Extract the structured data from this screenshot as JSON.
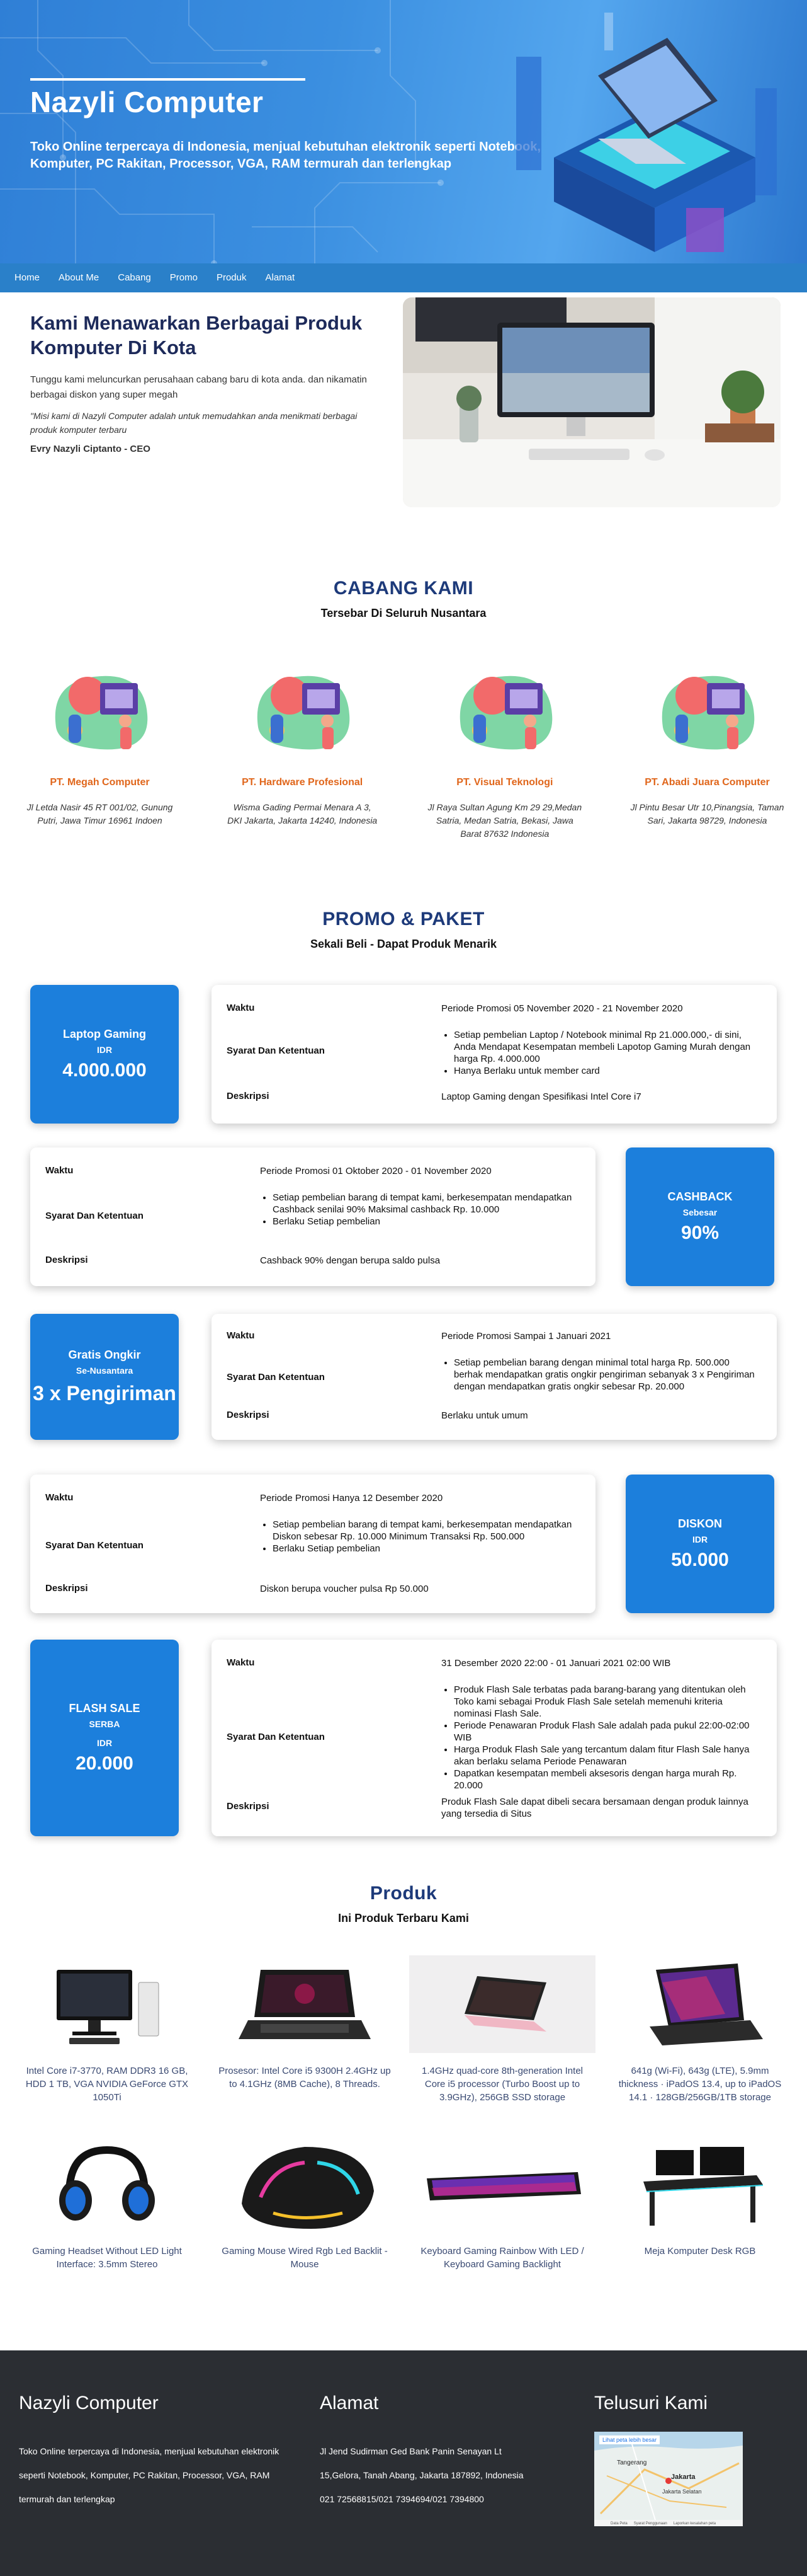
{
  "hero": {
    "title": "Nazyli Computer",
    "tagline": "Toko Online terpercaya di Indonesia, menjual kebutuhan elektronik seperti Notebook, Komputer, PC Rakitan, Processor, VGA, RAM termurah dan terlengkap"
  },
  "nav": [
    "Home",
    "About Me",
    "Cabang",
    "Promo",
    "Produk",
    "Alamat"
  ],
  "about": {
    "heading": "Kami Menawarkan Berbagai Produk Komputer Di Kota",
    "lead": "Tunggu kami meluncurkan perusahaan cabang baru di kota anda. dan nikamatin berbagai diskon yang super megah",
    "quote": "\"Misi kami di Nazyli Computer adalah untuk memudahkan anda menikmati berbagai produk komputer terbaru",
    "ceo": "Evry Nazyli Ciptanto - CEO"
  },
  "cabang": {
    "title": "CABANG KAMI",
    "subtitle": "Tersebar Di Seluruh Nusantara",
    "items": [
      {
        "name": "PT. Megah Computer",
        "address": "Jl Letda Nasir 45 RT 001/02, Gunung Putri, Jawa Timur 16961 Indoen"
      },
      {
        "name": "PT. Hardware Profesional",
        "address": "Wisma Gading Permai Menara A 3, DKI Jakarta, Jakarta 14240, Indonesia"
      },
      {
        "name": "PT. Visual Teknologi",
        "address": "Jl Raya Sultan Agung Km 29 29,Medan Satria, Medan Satria, Bekasi, Jawa Barat 87632 Indonesia"
      },
      {
        "name": "PT. Abadi Juara Computer",
        "address": "Jl Pintu Besar Utr 10,Pinangsia, Taman Sari, Jakarta 98729, Indonesia"
      }
    ]
  },
  "promo": {
    "title": "PROMO & PAKET",
    "subtitle": "Sekali Beli - Dapat Produk Menarik",
    "labels": {
      "waktu": "Waktu",
      "syarat": "Syarat Dan Ketentuan",
      "deskripsi": "Deskripsi"
    },
    "items": [
      {
        "badge": [
          "Laptop Gaming",
          "IDR",
          "4.000.000"
        ],
        "waktu": "Periode Promosi 05 November 2020 - 21 November 2020",
        "syarat": [
          "Setiap pembelian Laptop / Notebook minimal Rp 21.000.000,- di sini, Anda Mendapat Kesempatan membeli Lapotop Gaming Murah dengan harga Rp. 4.000.000",
          "Hanya Berlaku untuk member card"
        ],
        "deskripsi": "Laptop Gaming dengan Spesifikasi Intel Core i7"
      },
      {
        "badge": [
          "CASHBACK",
          "Sebesar",
          "90%"
        ],
        "waktu": "Periode Promosi 01 Oktober 2020 - 01 November 2020",
        "syarat": [
          "Setiap pembelian barang di tempat kami, berkesempatan mendapatkan Cashback senilai 90% Maksimal cashback Rp. 10.000",
          "Berlaku Setiap pembelian"
        ],
        "deskripsi": "Cashback 90% dengan berupa saldo pulsa"
      },
      {
        "badge": [
          "Gratis Ongkir",
          "Se-Nusantara",
          "3 x Pengiriman"
        ],
        "waktu": "Periode Promosi Sampai 1 Januari 2021",
        "syarat": [
          "Setiap pembelian barang dengan minimal total harga Rp. 500.000 berhak mendapatkan gratis ongkir pengiriman sebanyak 3 x Pengiriman dengan mendapatkan gratis ongkir sebesar Rp. 20.000"
        ],
        "deskripsi": "Berlaku untuk umum"
      },
      {
        "badge": [
          "DISKON",
          "IDR",
          "50.000"
        ],
        "waktu": "Periode Promosi Hanya 12 Desember 2020",
        "syarat": [
          "Setiap pembelian barang di tempat kami, berkesempatan mendapatkan Diskon sebesar Rp. 10.000 Minimum Transaksi Rp. 500.000",
          "Berlaku Setiap pembelian"
        ],
        "deskripsi": "Diskon berupa voucher pulsa Rp 50.000"
      },
      {
        "badge": [
          "FLASH SALE",
          "SERBA",
          "IDR",
          "20.000"
        ],
        "waktu": "31 Desember 2020 22:00 - 01 Januari 2021 02:00 WIB",
        "syarat": [
          "Produk Flash Sale terbatas pada barang-barang yang ditentukan oleh Toko kami sebagai Produk Flash Sale setelah memenuhi kriteria nominasi Flash Sale.",
          "Periode Penawaran Produk Flash Sale adalah pada pukul 22:00-02:00 WIB",
          "Harga Produk Flash Sale yang tercantum dalam fitur Flash Sale hanya akan berlaku selama Periode Penawaran",
          "Dapatkan kesempatan membeli aksesoris dengan harga murah Rp. 20.000"
        ],
        "deskripsi": "Produk Flash Sale dapat dibeli secara bersamaan dengan produk lainnya yang tersedia di Situs"
      }
    ]
  },
  "produk": {
    "title": "Produk",
    "subtitle": "Ini Produk Terbaru Kami",
    "items": [
      {
        "icon": "desktop-pc-icon",
        "desc": "Intel Core i7-3770, RAM DDR3 16 GB, HDD 1 TB, VGA NVIDIA GeForce GTX 1050Ti"
      },
      {
        "icon": "gaming-laptop-icon",
        "desc": "Prosesor: Intel Core i5 9300H 2.4GHz up to 4.1GHz (8MB Cache), 8 Threads."
      },
      {
        "icon": "pink-laptop-icon",
        "desc": "1.4GHz quad-core 8th-generation Intel Core i5 processor (Turbo Boost up to 3.9GHz), 256GB SSD storage"
      },
      {
        "icon": "tablet-keyboard-icon",
        "desc": "641g (Wi-Fi), 643g (LTE), 5.9mm thickness · iPadOS 13.4, up to iPadOS 14.1 · 128GB/256GB/1TB storage"
      },
      {
        "icon": "headset-icon",
        "desc": "Gaming Headset Without LED Light Interface: 3.5mm Stereo"
      },
      {
        "icon": "gaming-mouse-icon",
        "desc": "Gaming Mouse Wired Rgb Led Backlit - Mouse"
      },
      {
        "icon": "keyboard-icon",
        "desc": "Keyboard Gaming Rainbow With LED / Keyboard Gaming Backlight"
      },
      {
        "icon": "desk-icon",
        "desc": "Meja Komputer Desk RGB"
      }
    ]
  },
  "footer": {
    "col1": {
      "title": "Nazyli Computer",
      "text": "Toko Online terpercaya di Indonesia, menjual kebutuhan elektronik seperti Notebook, Komputer, PC Rakitan, Processor, VGA, RAM termurah dan terlengkap"
    },
    "col2": {
      "title": "Alamat",
      "lines": [
        "Jl Jend Sudirman Ged Bank Panin Senayan Lt",
        "15,Gelora, Tanah Abang, Jakarta 187892, Indonesia",
        "021 72568815/021 7394694/021 7394800"
      ]
    },
    "col3": {
      "title": "Telusuri Kami",
      "map_link": "Lihat peta lebih besar",
      "map_labels": [
        "Tangerang",
        "Jakarta",
        "Jakarta Selatan"
      ],
      "map_footer": [
        "Data Peta",
        "Syarat Penggunaan",
        "Laporkan kesalahan peta"
      ]
    }
  },
  "colors": {
    "hero_blue": "#3b8fe0",
    "nav_blue": "#2a80c9",
    "badge_blue": "#1c7fdc",
    "branch_orange": "#e0661b",
    "footer_dark": "#2b2e33",
    "heading_navy": "#1d3a7a"
  }
}
